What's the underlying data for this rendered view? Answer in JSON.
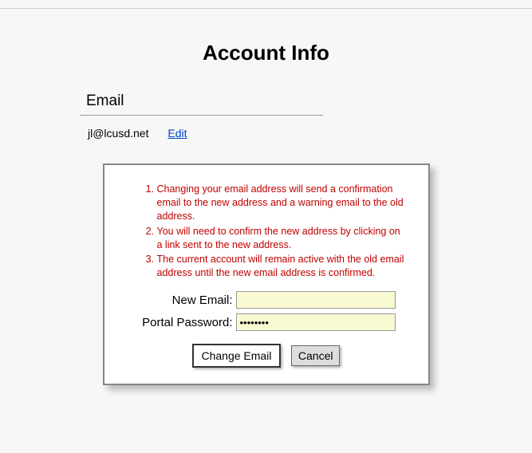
{
  "header": {
    "title": "Account Info"
  },
  "email_section": {
    "heading": "Email",
    "current_email": "jl@lcusd.net",
    "edit_label": "Edit"
  },
  "change_email_card": {
    "notices": [
      "Changing your email address will send a confirmation email to the new address and a warning email to the old address.",
      "You will need to confirm the new address by clicking on a link sent to the new address.",
      "The current account will remain active with the old email address until the new email address is confirmed."
    ],
    "new_email_label": "New Email:",
    "new_email_value": "",
    "password_label": "Portal Password:",
    "password_value": "••••••••",
    "change_button": "Change Email",
    "cancel_button": "Cancel"
  }
}
